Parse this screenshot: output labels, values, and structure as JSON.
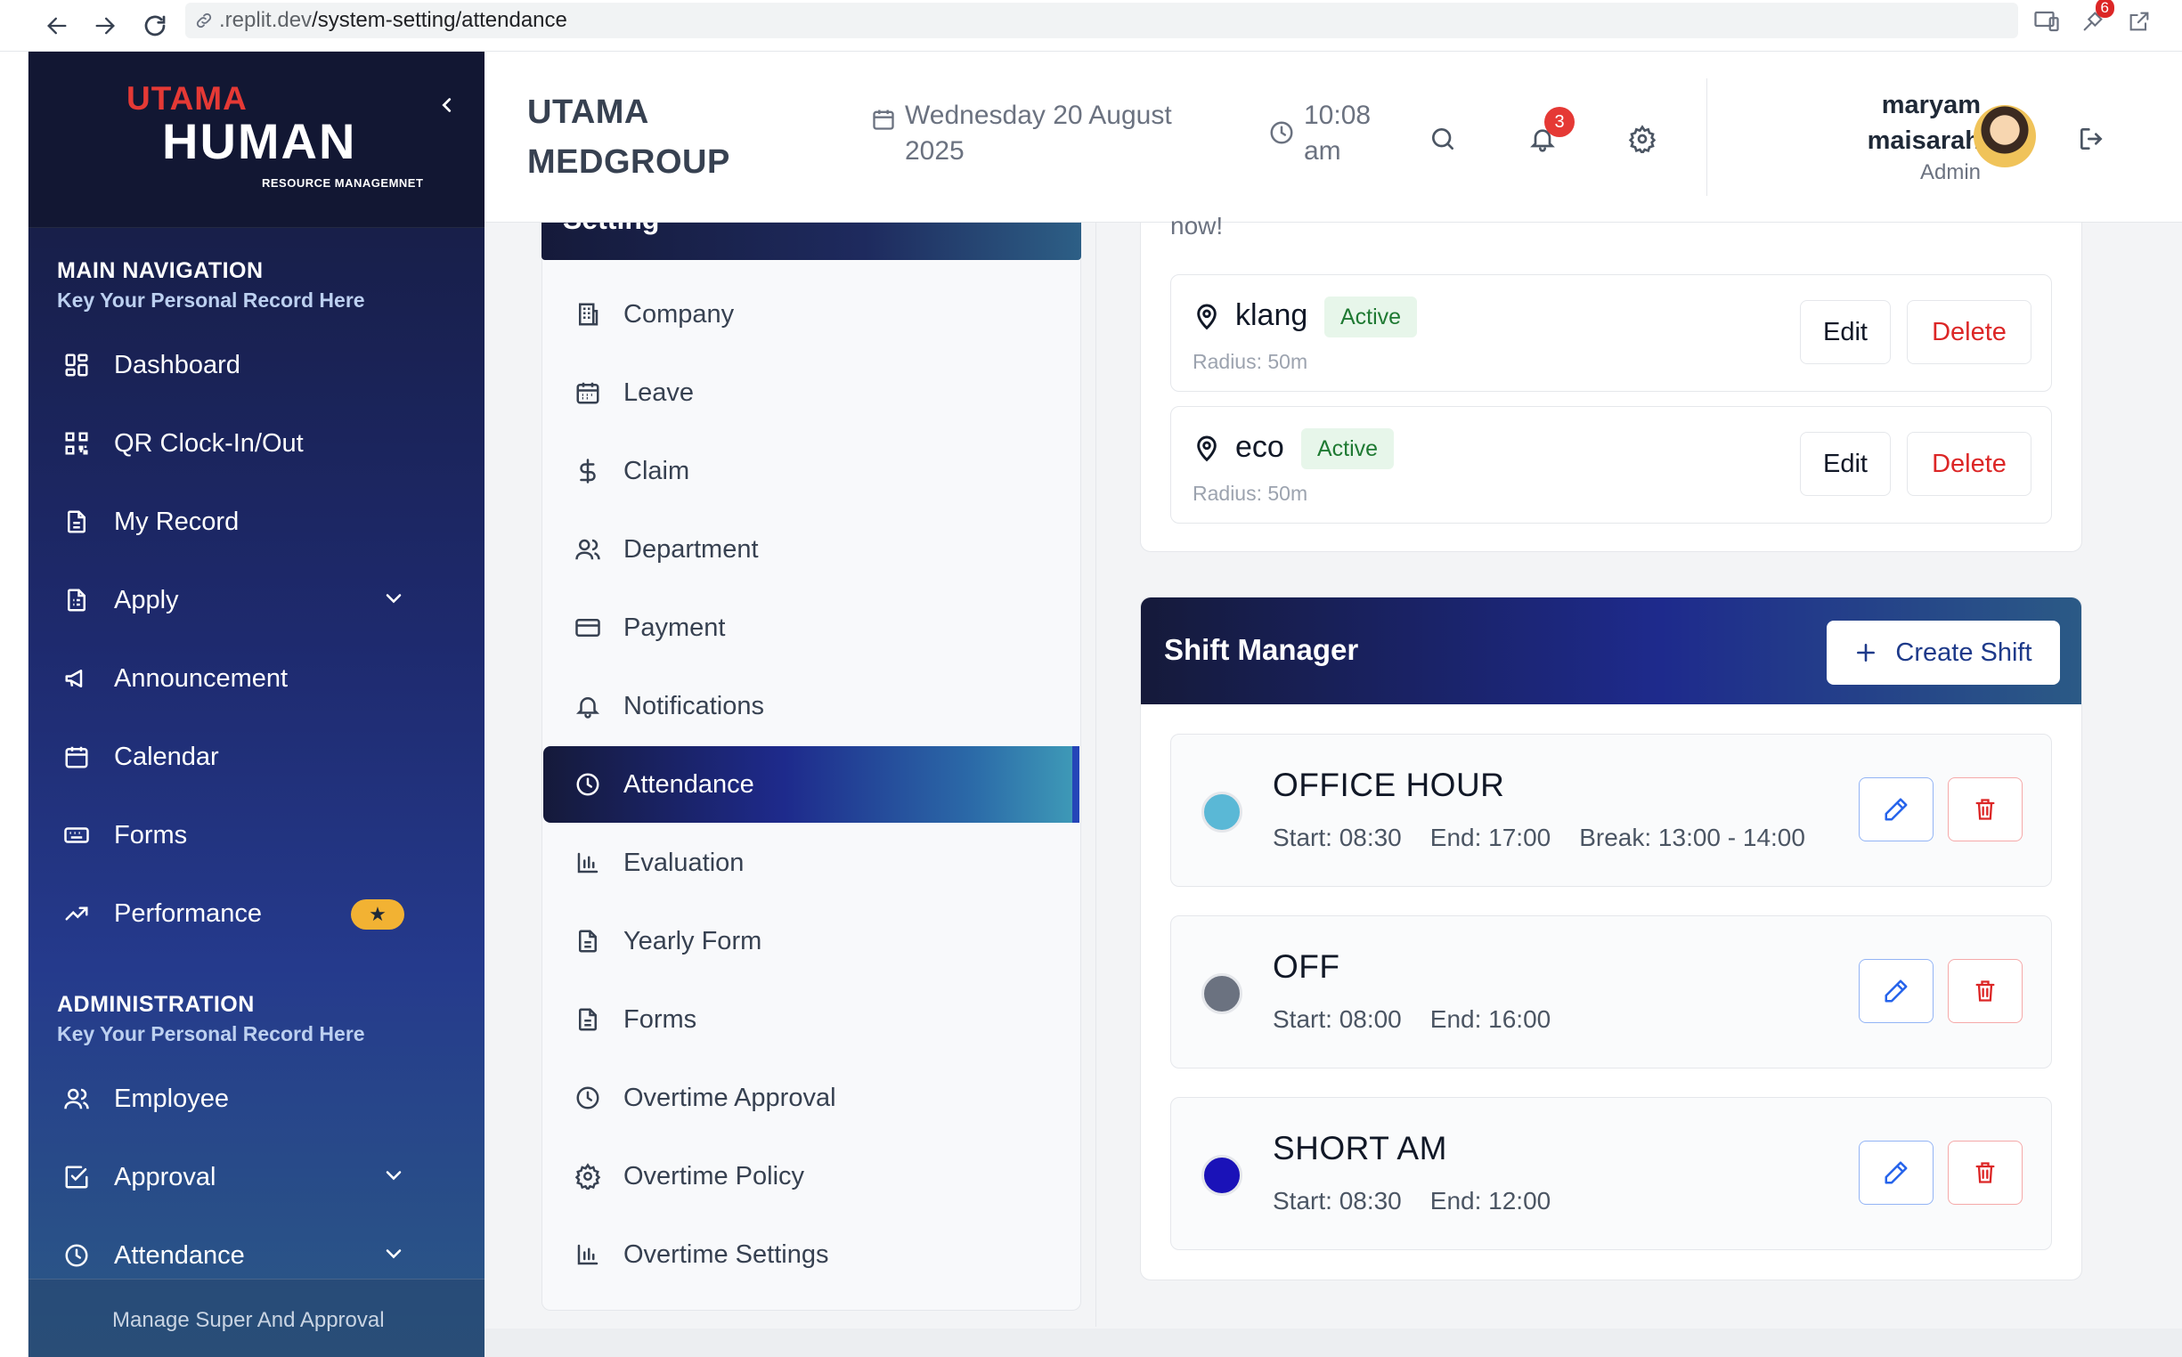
{
  "browser": {
    "url_domain": ".replit.dev",
    "url_path": "/system-setting/attendance",
    "extension_badge": "6"
  },
  "sidebar": {
    "logo_top": "UTAMA",
    "logo_main": "HUMAN",
    "logo_sub": "RESOURCE MANAGEMNET",
    "main_section_title": "MAIN NAVIGATION",
    "main_section_sub": "Key Your Personal Record Here",
    "main_items": [
      {
        "label": "Dashboard",
        "icon": "dashboard-icon"
      },
      {
        "label": "QR Clock-In/Out",
        "icon": "qr-code-icon"
      },
      {
        "label": "My Record",
        "icon": "document-icon"
      },
      {
        "label": "Apply",
        "icon": "form-icon"
      },
      {
        "label": "Announcement",
        "icon": "megaphone-icon"
      },
      {
        "label": "Calendar",
        "icon": "calendar-icon"
      },
      {
        "label": "Forms",
        "icon": "keyboard-icon"
      },
      {
        "label": "Performance",
        "icon": "trend-up-icon"
      }
    ],
    "admin_section_title": "ADMINISTRATION",
    "admin_section_sub": "Key Your Personal Record Here",
    "admin_items": [
      {
        "label": "Employee",
        "icon": "users-icon"
      },
      {
        "label": "Approval",
        "icon": "check-square-icon"
      },
      {
        "label": "Attendance",
        "icon": "clock-icon"
      }
    ],
    "footer_text": "Manage Super And Approval"
  },
  "header": {
    "company_name": "UTAMA MEDGROUP",
    "date": "Wednesday 20 August 2025",
    "time": "10:08 am",
    "notification_count": "3",
    "user_name": "maryam maisarah",
    "user_role": "Admin"
  },
  "settings": {
    "panel_title": "Setting",
    "items": [
      {
        "label": "Company",
        "icon": "building-icon"
      },
      {
        "label": "Leave",
        "icon": "calendar-grid-icon"
      },
      {
        "label": "Claim",
        "icon": "dollar-icon"
      },
      {
        "label": "Department",
        "icon": "users-icon"
      },
      {
        "label": "Payment",
        "icon": "credit-card-icon"
      },
      {
        "label": "Notifications",
        "icon": "bell-icon"
      },
      {
        "label": "Attendance",
        "icon": "clock-icon"
      },
      {
        "label": "Evaluation",
        "icon": "bar-chart-icon"
      },
      {
        "label": "Yearly Form",
        "icon": "document-icon"
      },
      {
        "label": "Forms",
        "icon": "document-icon"
      },
      {
        "label": "Overtime Approval",
        "icon": "clock-icon"
      },
      {
        "label": "Overtime Policy",
        "icon": "gear-icon"
      },
      {
        "label": "Overtime Settings",
        "icon": "bar-chart-icon"
      }
    ],
    "active_item": "Attendance"
  },
  "locations": {
    "partial_text": "now!",
    "items": [
      {
        "name": "klang",
        "status": "Active",
        "radius": "Radius: 50m",
        "edit_label": "Edit",
        "delete_label": "Delete"
      },
      {
        "name": "eco",
        "status": "Active",
        "radius": "Radius: 50m",
        "edit_label": "Edit",
        "delete_label": "Delete"
      }
    ]
  },
  "shift_manager": {
    "title": "Shift Manager",
    "create_label": "Create Shift",
    "shifts": [
      {
        "name": "OFFICE HOUR",
        "color": "#5ab8d6",
        "start": "Start: 08:30",
        "end": "End: 17:00",
        "break": "Break: 13:00 - 14:00"
      },
      {
        "name": "OFF",
        "color": "#6b7280",
        "start": "Start: 08:00",
        "end": "End: 16:00"
      },
      {
        "name": "SHORT AM",
        "color": "#1a12b8",
        "start": "Start: 08:30",
        "end": "End: 12:00"
      }
    ]
  },
  "colors": {
    "sidebar_dark": "#151a3a",
    "accent_blue": "#1e2a8c",
    "active_green_bg": "#e7f6ea",
    "delete_red": "#dc2626"
  }
}
